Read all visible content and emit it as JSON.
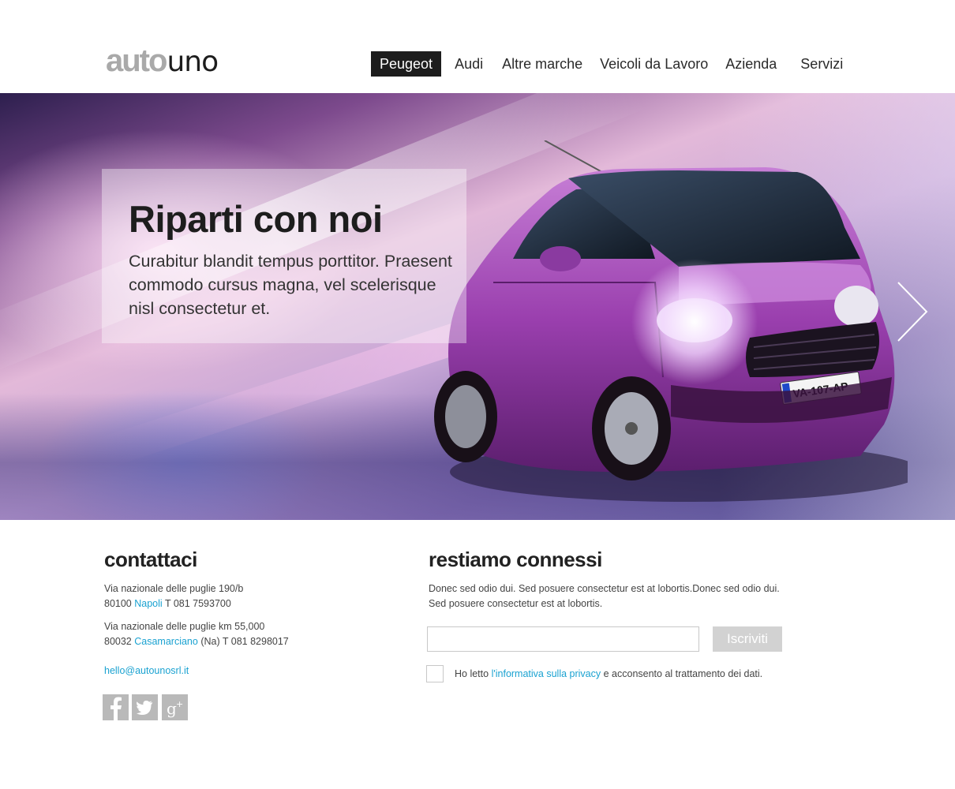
{
  "brand": {
    "logo_part1": "auto",
    "logo_part2": "uno"
  },
  "nav": {
    "items": [
      {
        "label": "Peugeot",
        "active": true
      },
      {
        "label": "Audi",
        "active": false
      },
      {
        "label": "Altre marche",
        "active": false
      },
      {
        "label": "Veicoli da Lavoro",
        "active": false
      },
      {
        "label": "Azienda",
        "active": false
      },
      {
        "label": "Servizi",
        "active": false
      }
    ]
  },
  "hero": {
    "title": "Riparti con noi",
    "text": "Curabitur blandit tempus porttitor. Praesent commodo cursus magna, vel scelerisque nisl consectetur et.",
    "next_icon": "chevron-right-icon",
    "license_plate": "VA-107-AP"
  },
  "contact": {
    "title": "contattaci",
    "address1_line1": "Via nazionale delle puglie 190/b",
    "address1_cap": "80100",
    "address1_city": "Napoli",
    "address1_phone": "T 081 7593700",
    "address2_line1": "Via nazionale delle puglie km 55,000",
    "address2_cap": "80032",
    "address2_city": "Casamarciano",
    "address2_rest": "(Na) T 081 8298017",
    "email": "hello@autounosrl.it",
    "social": [
      {
        "icon": "facebook-icon",
        "glyph": "f"
      },
      {
        "icon": "twitter-icon",
        "glyph": "t"
      },
      {
        "icon": "google-plus-icon",
        "glyph": "g+"
      }
    ]
  },
  "newsletter": {
    "title": "restiamo connessi",
    "description": "Donec sed odio dui. Sed posuere consectetur est at lobortis.Donec sed odio dui. Sed posuere consectetur est at lobortis.",
    "email_value": "",
    "subscribe_label": "Iscriviti",
    "privacy_prefix": "Ho letto",
    "privacy_link": "l'informativa sulla privacy",
    "privacy_suffix": "e acconsento al trattamento dei dati."
  },
  "colors": {
    "accent_link": "#1aa2d1",
    "nav_active_bg": "#1d1d1d",
    "button_bg": "#d2d2d2"
  }
}
